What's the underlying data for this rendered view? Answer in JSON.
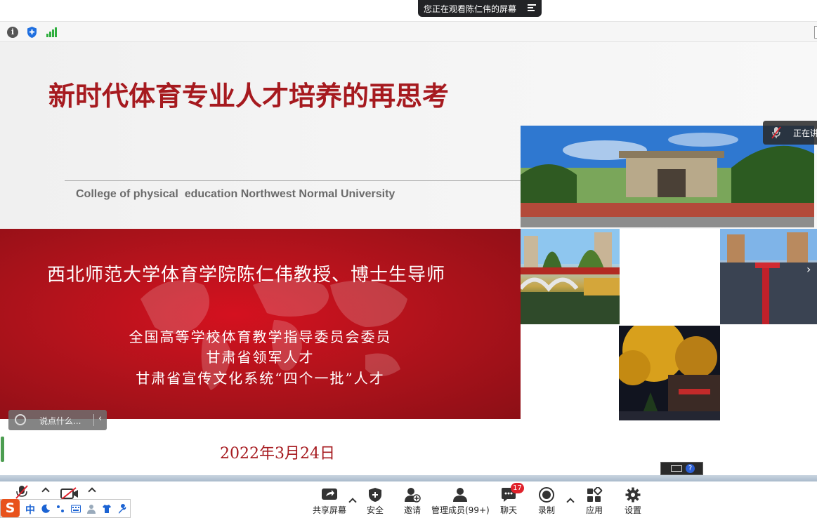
{
  "banner": {
    "viewing_text": "您正在观看陈仁伟的屏幕"
  },
  "slide": {
    "title": "新时代体育专业人才培养的再思考",
    "college": "College of physical  education Northwest Normal University",
    "name_line": "西北师范大学体育学院陈仁伟教授、博士生导师",
    "roles": [
      "全国高等学校体育教学指导委员会委员",
      "甘肃省领军人才",
      "甘肃省宣传文化系统“四个一批”人才"
    ],
    "date": "2022年3月24日"
  },
  "comment": {
    "placeholder": "说点什么..."
  },
  "speaker": {
    "label": "正在讲"
  },
  "toolbar": {
    "share_label": "共享屏幕",
    "security_label": "安全",
    "invite_label": "邀请",
    "participants_label": "管理成员(99+)",
    "chat_label": "聊天",
    "chat_badge": "17",
    "record_label": "录制",
    "apps_label": "应用",
    "settings_label": "设置"
  },
  "ime": {
    "mode": "中",
    "logo": "S"
  },
  "icons": {
    "info": "info-icon",
    "shield": "shield-icon",
    "signal": "signal-icon",
    "mic": "microphone-muted-icon",
    "camera": "camera-off-icon"
  },
  "colors": {
    "title_red": "#a61a1f",
    "panel_red": "#c4121c",
    "banner_dark": "#222326",
    "badge_red": "#e0222c",
    "signal_green": "#2fae3e",
    "ime_orange": "#e8521c"
  }
}
